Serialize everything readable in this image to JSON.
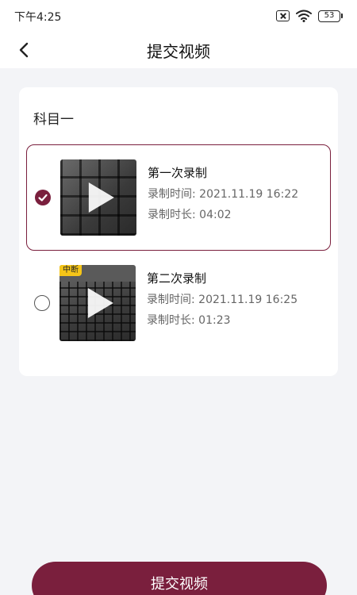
{
  "status_bar": {
    "time": "下午4:25",
    "battery": "53",
    "icons": [
      "sim-blocked-icon",
      "wifi-icon",
      "battery-icon"
    ]
  },
  "nav": {
    "back_icon": "chevron-left-icon",
    "title": "提交视频"
  },
  "subject": {
    "title": "科目一"
  },
  "recordings": [
    {
      "name": "第一次录制",
      "time_label": "录制时间: 2021.11.19 16:22",
      "duration_label": "录制时长: 04:02",
      "selected": true,
      "badge": ""
    },
    {
      "name": "第二次录制",
      "time_label": "录制时间: 2021.11.19 16:25",
      "duration_label": "录制时长: 01:23",
      "selected": false,
      "badge": "中断"
    }
  ],
  "submit": {
    "label": "提交视频"
  },
  "colors": {
    "accent": "#7a1f3d",
    "badge": "#f5c518",
    "background": "#f3f4f7"
  }
}
